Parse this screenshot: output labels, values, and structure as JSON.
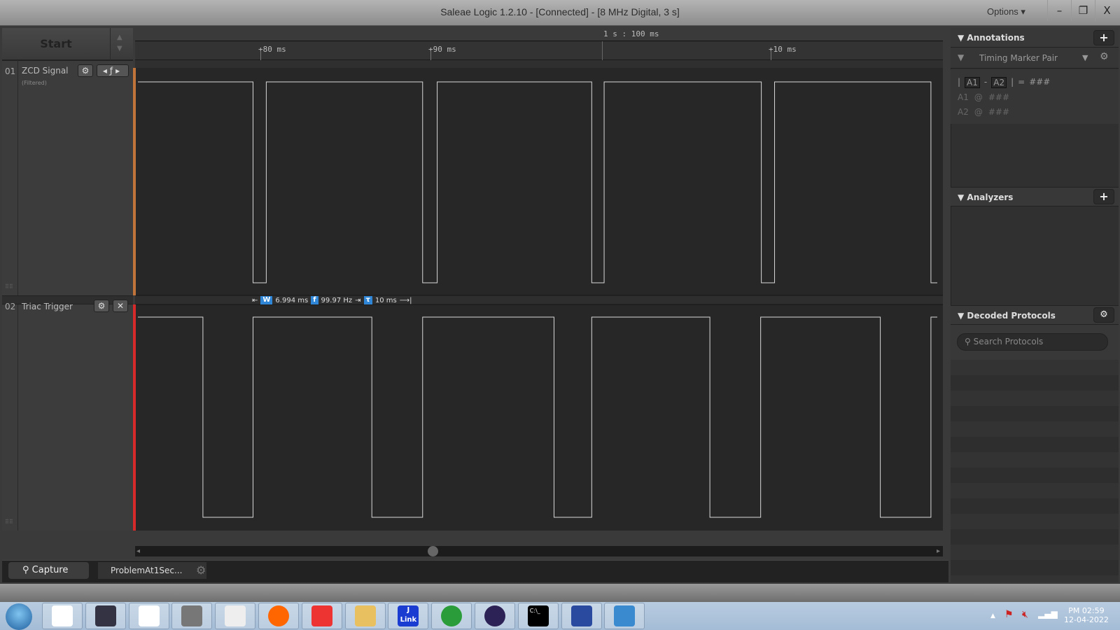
{
  "window": {
    "title": "Saleae Logic 1.2.10 - [Connected] - [8 MHz Digital, 3 s]",
    "options_label": "Options ▾",
    "minimize": "–",
    "restore": "❐",
    "close": "X"
  },
  "capture": {
    "start_label": "Start"
  },
  "timeline": {
    "reference": "1 s : 100 ms",
    "ticks": [
      "+80 ms",
      "+90 ms",
      "+10 ms"
    ],
    "unit": "ms"
  },
  "channels": [
    {
      "number": "01",
      "name": "ZCD Signal",
      "subtitle": "(Filtered)",
      "color": "#c0743a"
    },
    {
      "number": "02",
      "name": "Triac Trigger",
      "color": "#d62a2a"
    }
  ],
  "measurement": {
    "width_icon": "W",
    "width": "6.994 ms",
    "freq_icon": "f",
    "frequency": "99.97 Hz",
    "period_icon": "τ",
    "period": "10 ms"
  },
  "waveforms": {
    "time_unit": "ms after 1 s",
    "view_range": [
      72.8,
      120.5
    ],
    "zcd_signal": {
      "initial": 1,
      "edges": [
        79.67,
        80.46,
        89.79,
        90.66,
        99.88,
        100.62,
        110.0,
        110.79,
        120.12
      ]
    },
    "triac_trigger": {
      "initial": 1,
      "edges": [
        76.68,
        79.67,
        86.76,
        89.79,
        97.63,
        99.88,
        106.93,
        109.96,
        117.1,
        120.12
      ]
    }
  },
  "tabs": {
    "capture": "Capture",
    "session": "ProblemAt1Sec..."
  },
  "annotations": {
    "title": "Annotations",
    "marker_type": "Timing Marker Pair",
    "a1": "A1",
    "a2": "A2",
    "diff_value": "###",
    "a1_label": "A1",
    "a2_label": "A2",
    "at": "@",
    "a1_value": "###",
    "a2_value": "###"
  },
  "analyzers": {
    "title": "Analyzers"
  },
  "decoded": {
    "title": "Decoded Protocols",
    "search_placeholder": "Search Protocols"
  },
  "taskbar": {
    "apps": [
      "start",
      "dog-app",
      "x-app",
      "clickup",
      "chip-tool",
      "logic-analyzer",
      "firefox",
      "silabs",
      "file-explorer",
      "jlink",
      "chrome",
      "eclipse",
      "cmd",
      "remote-desktop",
      "photo-viewer"
    ],
    "jlink_text": "J Link",
    "cmd_text": "C:\\_",
    "time": "PM 02:59",
    "date": "12-04-2022"
  }
}
